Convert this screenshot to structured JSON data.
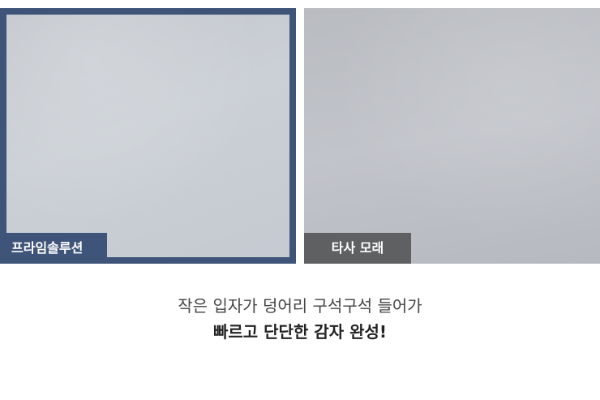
{
  "comparison": {
    "left": {
      "label": "프라임솔루션",
      "frame_color": "#3f5479"
    },
    "right": {
      "label": "타사 모래",
      "label_bg_color": "#5f6061"
    }
  },
  "caption": {
    "line1": "작은 입자가 덩어리 구석구석 들어가",
    "line2": "빠르고 단단한 감자 완성!"
  }
}
